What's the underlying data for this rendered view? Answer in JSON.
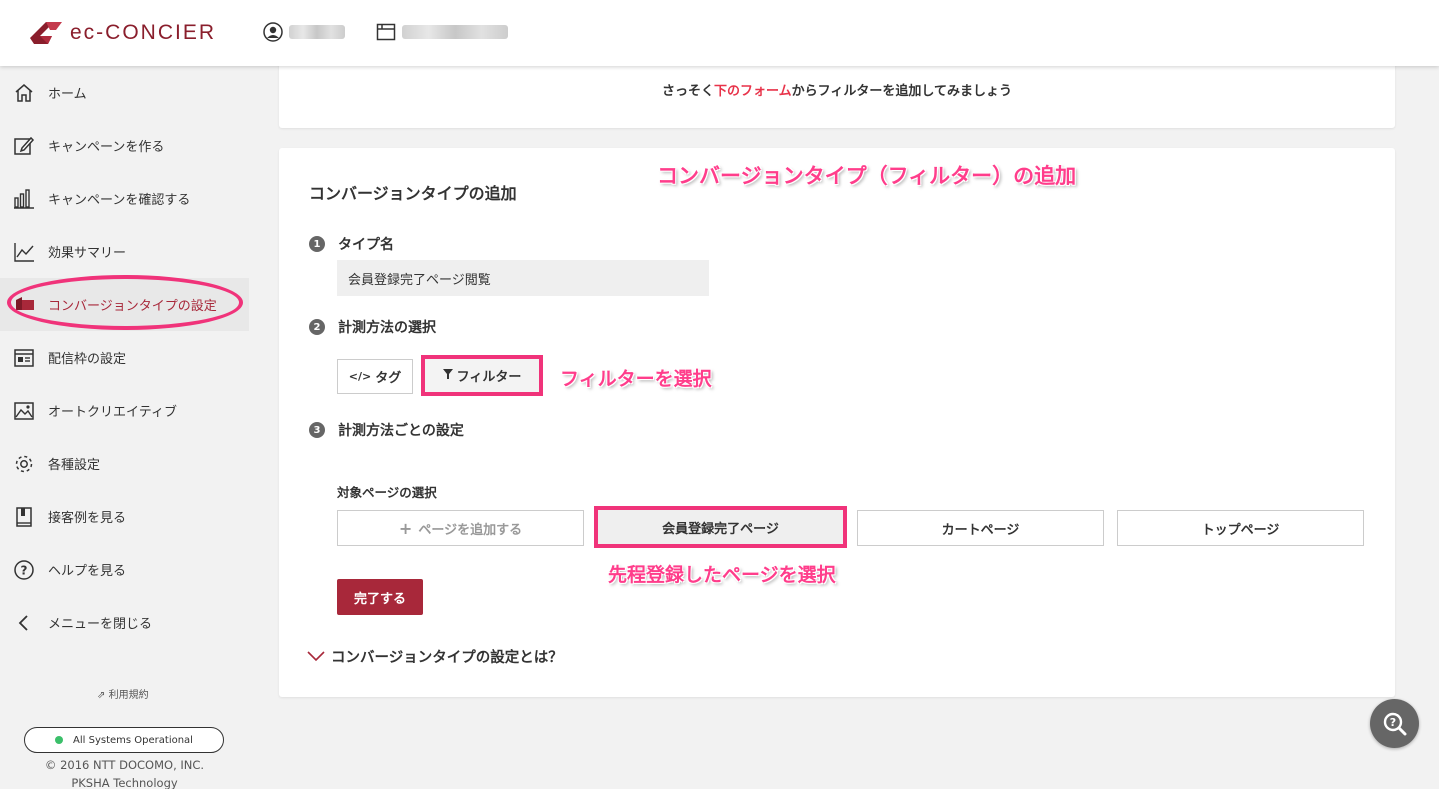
{
  "header": {
    "logo_text": "ec-CONCIER",
    "brand_color": "#8a1e2c"
  },
  "sidebar": {
    "items": [
      {
        "label": "ホーム",
        "icon": "home-icon"
      },
      {
        "label": "キャンペーンを作る",
        "icon": "edit-icon"
      },
      {
        "label": "キャンペーンを確認する",
        "icon": "bar-chart-icon"
      },
      {
        "label": "効果サマリー",
        "icon": "line-chart-icon"
      },
      {
        "label": "コンバージョンタイプの設定",
        "icon": "conversion-icon",
        "active": true
      },
      {
        "label": "配信枠の設定",
        "icon": "layout-icon"
      },
      {
        "label": "オートクリエイティブ",
        "icon": "image-icon"
      },
      {
        "label": "各種設定",
        "icon": "gear-icon"
      },
      {
        "label": "接客例を見る",
        "icon": "book-icon"
      },
      {
        "label": "ヘルプを見る",
        "icon": "help-icon"
      },
      {
        "label": "メニューを閉じる",
        "icon": "chevron-left-icon"
      }
    ],
    "terms_label": "利用規約",
    "status_text": "All Systems Operational",
    "copyright_line1": "© 2016 NTT DOCOMO, INC.",
    "copyright_line2": "PKSHA Technology"
  },
  "intro": {
    "before": "さっそく",
    "link": "下のフォーム",
    "after": "からフィルターを追加してみましょう"
  },
  "form": {
    "title": "コンバージョンタイプの追加",
    "step1": {
      "num": "1",
      "label": "タイプ名",
      "value": "会員登録完了ページ閲覧"
    },
    "step2": {
      "num": "2",
      "label": "計測方法の選択",
      "tag_label": "タグ",
      "filter_label": "フィルター"
    },
    "step3": {
      "num": "3",
      "label": "計測方法ごとの設定"
    },
    "target_label": "対象ページの選択",
    "pages": [
      {
        "label": "ページを追加する"
      },
      {
        "label": "会員登録完了ページ"
      },
      {
        "label": "カートページ"
      },
      {
        "label": "トップページ"
      }
    ],
    "done_label": "完了する",
    "faq_label": "コンバージョンタイプの設定とは？"
  },
  "annotations": {
    "title": "コンバージョンタイプ（フィルター）の追加",
    "filter": "フィルターを選択",
    "page": "先程登録したページを選択",
    "color": "#ff3d8b"
  },
  "colors": {
    "accent": "#a8283a",
    "highlight": "#f0337a",
    "status_ok": "#3bbf6a"
  }
}
